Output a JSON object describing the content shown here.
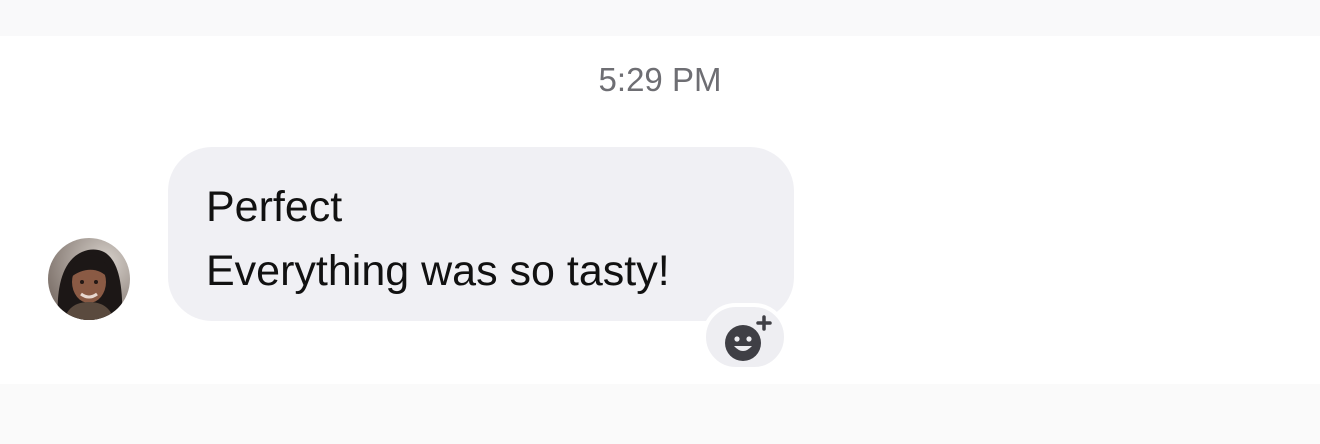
{
  "conversation": {
    "timestamp": "5:29 PM",
    "message": {
      "lines": [
        "Perfect",
        "Everything was so tasty!"
      ],
      "sender_avatar": "avatar-icon",
      "reaction_button_icon": "add-reaction-smiley-icon"
    }
  },
  "colors": {
    "bubble": "#f0f0f4",
    "timestamp_text": "#6e6e73",
    "message_text": "#111111"
  }
}
